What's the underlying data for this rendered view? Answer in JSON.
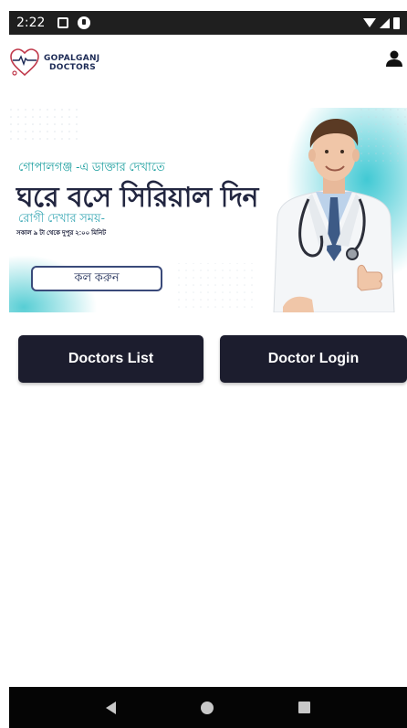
{
  "status_bar": {
    "time": "2:22"
  },
  "header": {
    "logo_line1": "GOPALGANJ",
    "logo_line2": "DOCTORS"
  },
  "banner": {
    "subtitle": "গোপালগঞ্জ -এ ডাক্তার দেখাতে",
    "title": "ঘরে বসে সিরিয়াল দিন",
    "time_label": "রোগী দেখার সময়-",
    "time_value": "সকাল ৯ টা থেকে দুপুর ২:০০ মিনিট",
    "call_button": "কল করুন"
  },
  "actions": {
    "doctors_list": "Doctors List",
    "doctor_login": "Doctor Login"
  },
  "colors": {
    "accent_dark": "#1c1d2e",
    "teal": "#1a9e9e",
    "brand_navy": "#1d2b56",
    "logo_red": "#c0394b"
  },
  "icons": {
    "wifi": "wifi-icon",
    "signal": "signal-icon",
    "battery": "battery-icon",
    "user": "user-icon",
    "back": "back-icon",
    "home": "home-icon",
    "recents": "recents-icon"
  }
}
